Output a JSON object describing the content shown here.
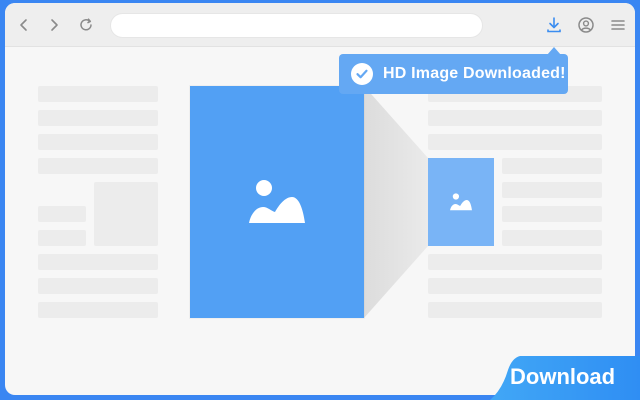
{
  "toolbar": {
    "back_icon": "chevron-left-icon",
    "forward_icon": "chevron-right-icon",
    "reload_icon": "reload-icon",
    "download_icon": "download-icon",
    "account_icon": "account-icon",
    "menu_icon": "menu-icon",
    "address_value": ""
  },
  "toast": {
    "text": "HD Image Downloaded!",
    "icon": "check-circle-icon"
  },
  "cta": {
    "label": "Download"
  },
  "images": {
    "large_icon": "image-icon",
    "small_icon": "image-icon"
  },
  "colors": {
    "frame": "#3a86f2",
    "card_large": "#52a0f4",
    "card_small": "#79b4f6",
    "toast": "#64a8f3",
    "placeholder": "#ececec",
    "cta": "#4aa6f7"
  }
}
